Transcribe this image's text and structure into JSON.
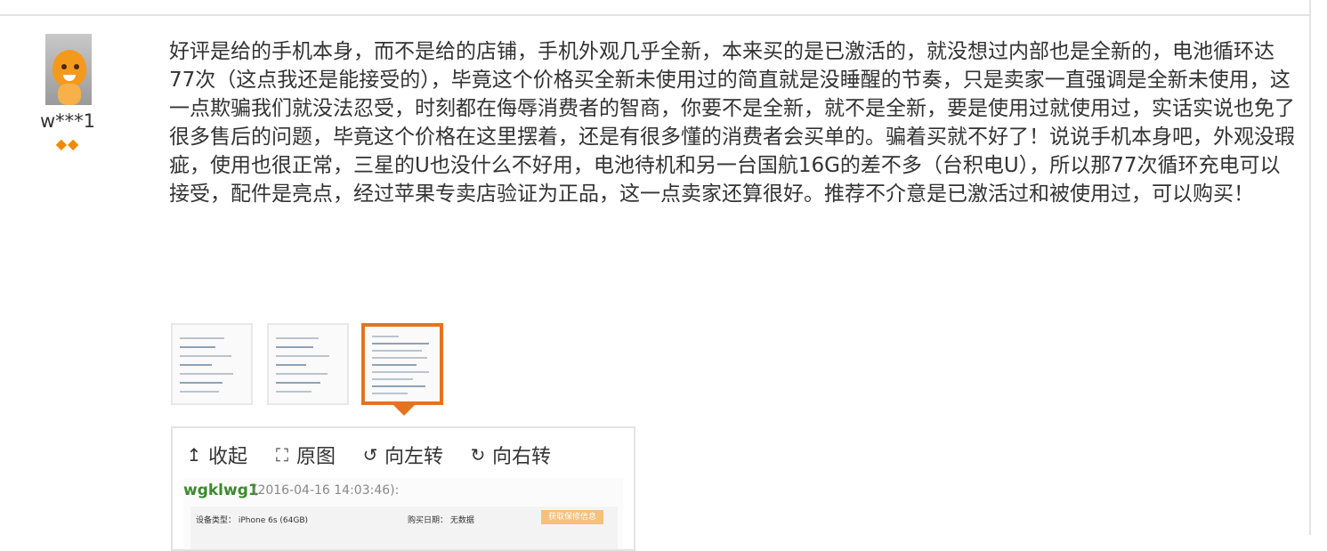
{
  "user": {
    "name": "w***1",
    "badges": "◆◆"
  },
  "review": {
    "text": "好评是给的手机本身，而不是给的店铺，手机外观几乎全新，本来买的是已激活的，就没想过内部也是全新的，电池循环达77次（这点我还是能接受的），毕竟这个价格买全新未使用过的简直就是没睡醒的节奏，只是卖家一直强调是全新未使用，这一点欺骗我们就没法忍受，时刻都在侮辱消费者的智商，你要不是全新，就不是全新，要是使用过就使用过，实话实说也免了很多售后的问题，毕竟这个价格在这里摆着，还是有很多懂的消费者会买单的。骗着买就不好了！说说手机本身吧，外观没瑕疵，使用也很正常，三星的U也没什么不好用，电池待机和另一台国航16G的差不多（台积电U），所以那77次循环充电可以接受，配件是亮点，经过苹果专卖店验证为正品，这一点卖家还算很好。推荐不介意是已激活过和被使用过，可以购买！"
  },
  "thumbnails": [
    {
      "name": "thumb-1",
      "active": false
    },
    {
      "name": "thumb-2",
      "active": false
    },
    {
      "name": "thumb-3",
      "active": true
    }
  ],
  "viewer": {
    "collapse_label": "收起",
    "original_label": "原图",
    "rotate_left_label": "向左转",
    "rotate_right_label": "向右转",
    "preview_user": "wgklwg1",
    "preview_time": "(2016-04-16 14:03:46):",
    "preview_device": "设备类型： iPhone 6s  (64GB)",
    "preview_date": "购买日期： 无数据",
    "preview_button": "获取保修信息"
  },
  "colors": {
    "accent": "#e4731f",
    "text": "#333333",
    "border": "#e3e3e3"
  }
}
